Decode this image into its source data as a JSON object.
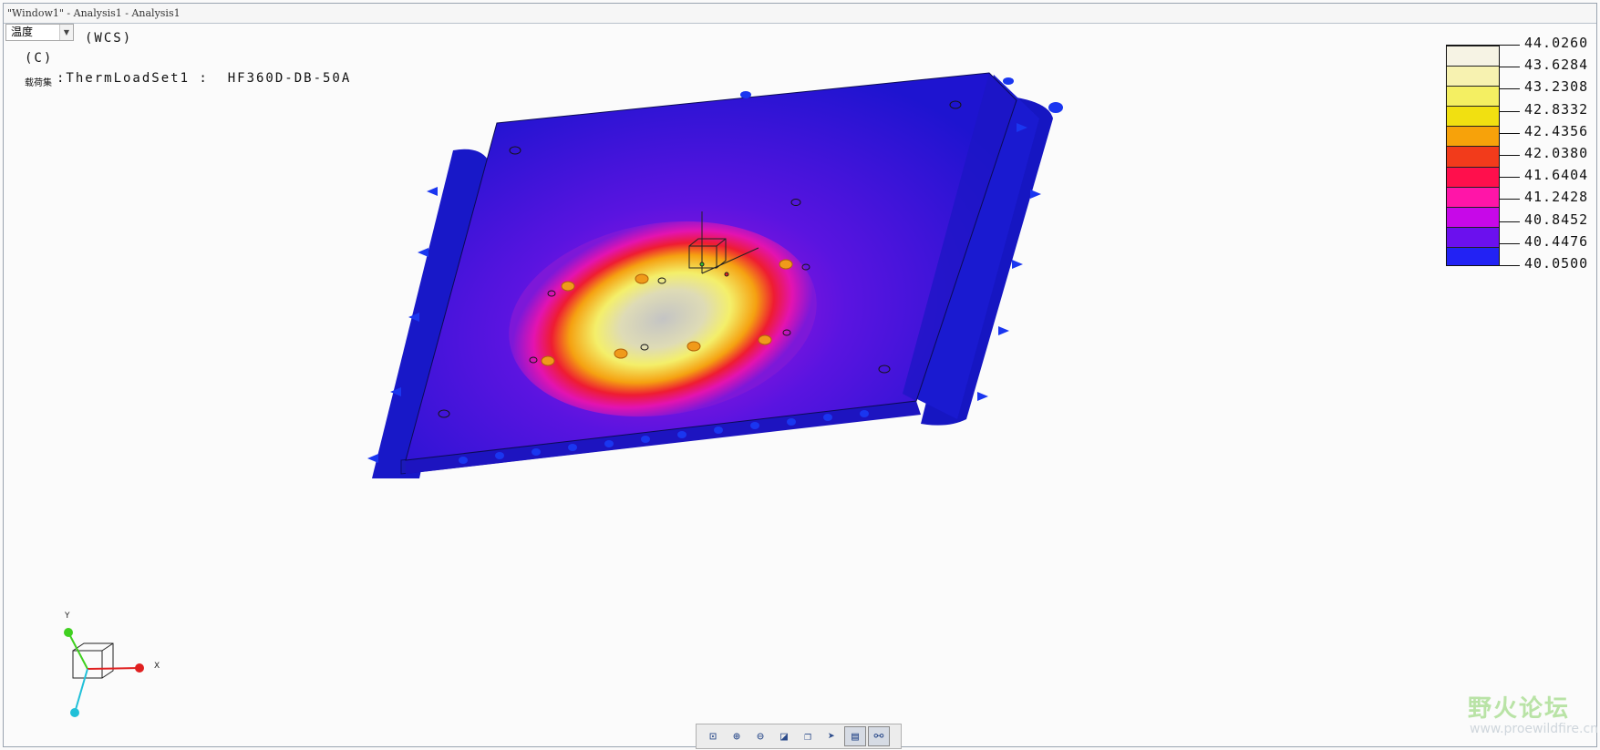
{
  "window": {
    "title": "\"Window1\" - Analysis1 - Analysis1"
  },
  "result_selector": {
    "value": "温度"
  },
  "overlay": {
    "coord_system": "(WCS)",
    "unit": "(C)",
    "loadset_prefix": "载荷集",
    "loadset_text": ":ThermLoadSet1 :  HF360D-DB-50A"
  },
  "legend": {
    "values": [
      "44.0260",
      "43.6284",
      "43.2308",
      "42.8332",
      "42.4356",
      "42.0380",
      "41.6404",
      "41.2428",
      "40.8452",
      "40.4476",
      "40.0500"
    ],
    "colors": [
      "#f6f3e4",
      "#f7f2b0",
      "#f4ef62",
      "#f1e011",
      "#f7a20a",
      "#f23b1b",
      "#ff0f4c",
      "#ff15a8",
      "#c708e8",
      "#6b10ee",
      "#2222f4"
    ]
  },
  "triad": {
    "x_label": "X",
    "y_label": "Y"
  },
  "toolbar": {
    "buttons": [
      {
        "name": "refit-icon",
        "glyph": "⊡"
      },
      {
        "name": "zoom-in-icon",
        "glyph": "⊕"
      },
      {
        "name": "zoom-out-icon",
        "glyph": "⊖"
      },
      {
        "name": "repaint-icon",
        "glyph": "◪"
      },
      {
        "name": "saved-views-icon",
        "glyph": "❐"
      },
      {
        "name": "spin-center-icon",
        "glyph": "➤"
      },
      {
        "name": "display-style-icon",
        "glyph": "▤"
      },
      {
        "name": "view-manager-icon",
        "glyph": "⚯"
      }
    ]
  },
  "watermark": {
    "text": "野火论坛",
    "url": "www.proewildfire.cn"
  }
}
